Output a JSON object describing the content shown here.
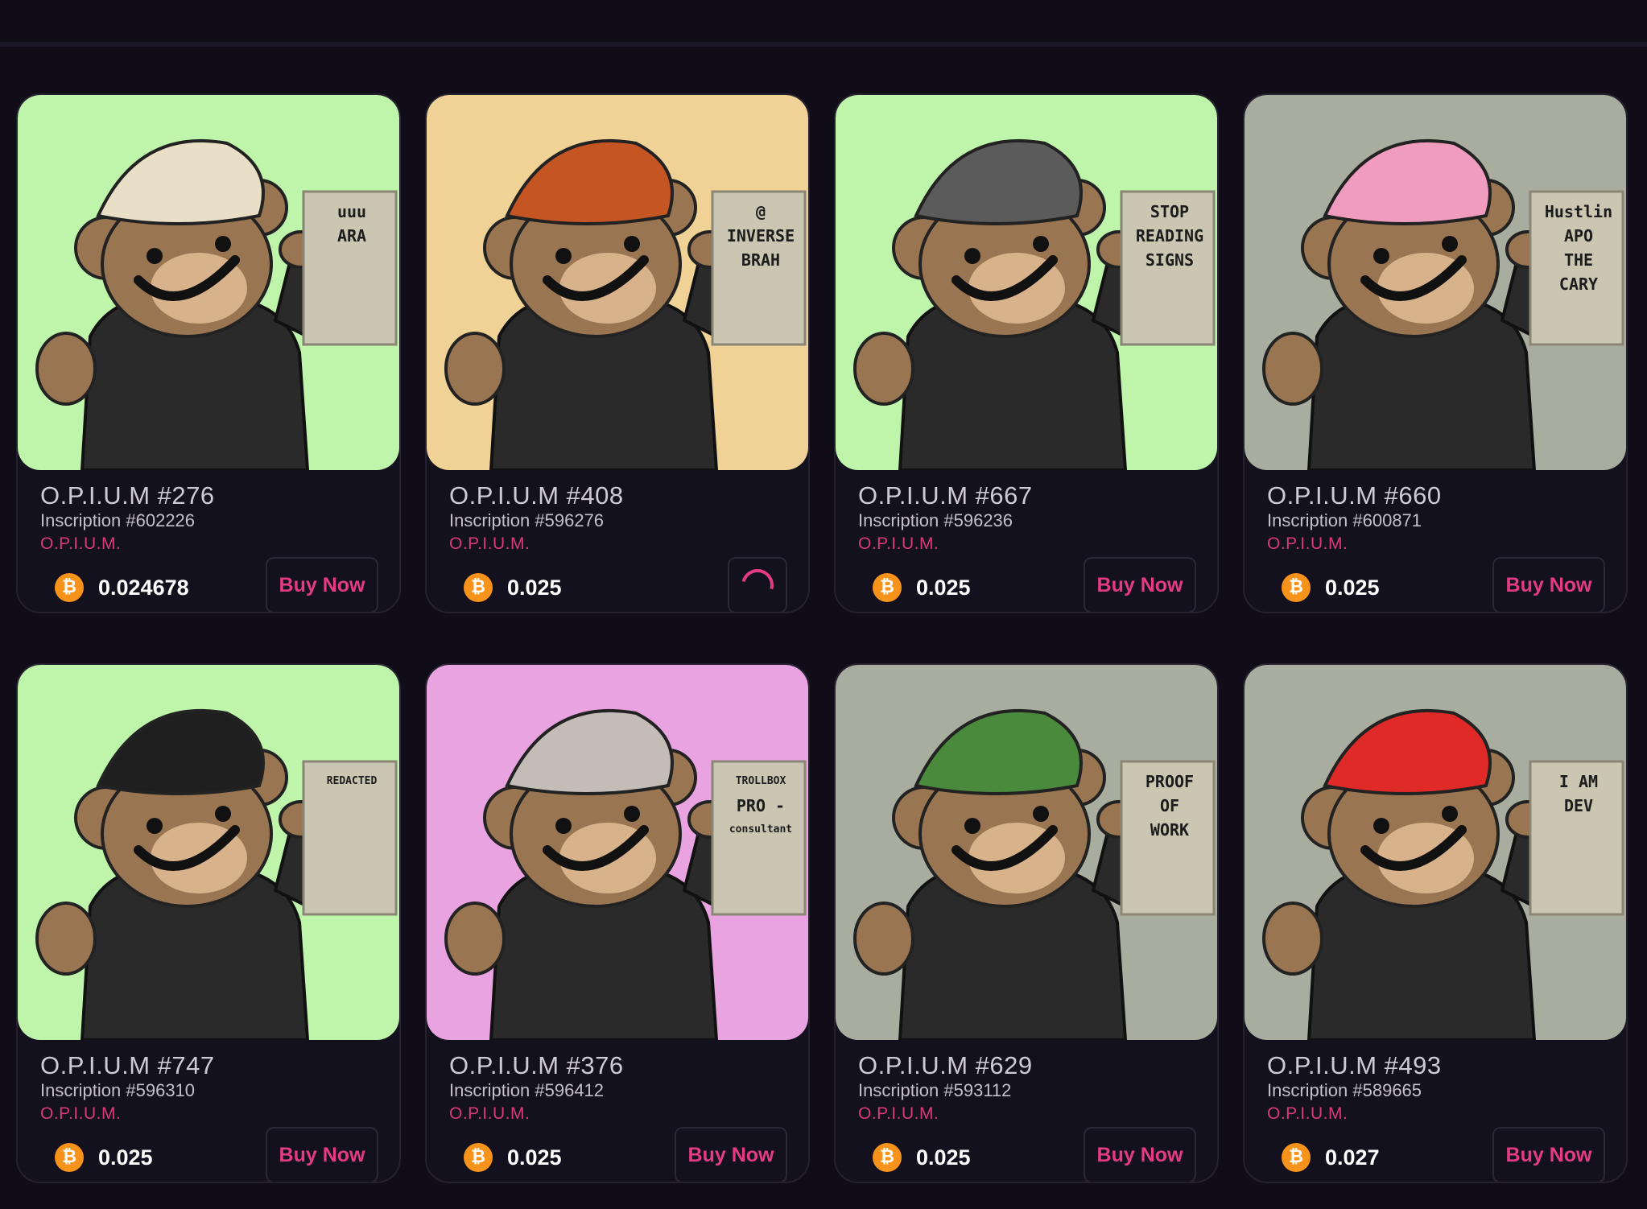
{
  "cards": [
    {
      "title": "O.P.I.U.M #276",
      "inscription": "Inscription #602226",
      "collection": "O.P.I.U.M.",
      "price": "0.024678",
      "button": "Buy Now",
      "bg": "#bff5ab",
      "sign": [
        "uuu",
        "ARA"
      ],
      "hat": "#e8dfc6"
    },
    {
      "title": "O.P.I.U.M #408",
      "inscription": "Inscription #596276",
      "collection": "O.P.I.U.M.",
      "price": "0.025",
      "button": "",
      "bg": "#f0d296",
      "sign": [
        "@",
        "INVERSE",
        "BRAH"
      ],
      "hat": "#c55624"
    },
    {
      "title": "O.P.I.U.M #667",
      "inscription": "Inscription #596236",
      "collection": "O.P.I.U.M.",
      "price": "0.025",
      "button": "Buy Now",
      "bg": "#bff5ab",
      "sign": [
        "STOP",
        "READING",
        "SIGNS"
      ],
      "hat": "#5b5b5b"
    },
    {
      "title": "O.P.I.U.M #660",
      "inscription": "Inscription #600871",
      "collection": "O.P.I.U.M.",
      "price": "0.025",
      "button": "Buy Now",
      "bg": "#a9ad9f",
      "sign": [
        "Hustlin",
        "APO",
        "THE",
        "CARY"
      ],
      "hat": "#f09cbf"
    },
    {
      "title": "O.P.I.U.M #747",
      "inscription": "Inscription #596310",
      "collection": "O.P.I.U.M.",
      "price": "0.025",
      "button": "Buy Now",
      "bg": "#bff5ab",
      "sign": [
        "REDACTED"
      ],
      "hat": "#1f1f1f"
    },
    {
      "title": "O.P.I.U.M #376",
      "inscription": "Inscription #596412",
      "collection": "O.P.I.U.M.",
      "price": "0.025",
      "button": "Buy Now",
      "bg": "#e8a3e0",
      "sign": [
        "TROLLBOX",
        "PRO -",
        "consultant"
      ],
      "hat": "#c3bcb7"
    },
    {
      "title": "O.P.I.U.M #629",
      "inscription": "Inscription #593112",
      "collection": "O.P.I.U.M.",
      "price": "0.025",
      "button": "Buy Now",
      "bg": "#a9ad9f",
      "sign": [
        "PROOF",
        "OF",
        "WORK"
      ],
      "hat": "#4a8a3c"
    },
    {
      "title": "O.P.I.U.M #493",
      "inscription": "Inscription #589665",
      "collection": "O.P.I.U.M.",
      "price": "0.027",
      "button": "Buy Now",
      "bg": "#a9ad9f",
      "sign": [
        "I AM",
        "DEV"
      ],
      "hat": "#e02a28"
    }
  ],
  "btc_symbol": "₿"
}
